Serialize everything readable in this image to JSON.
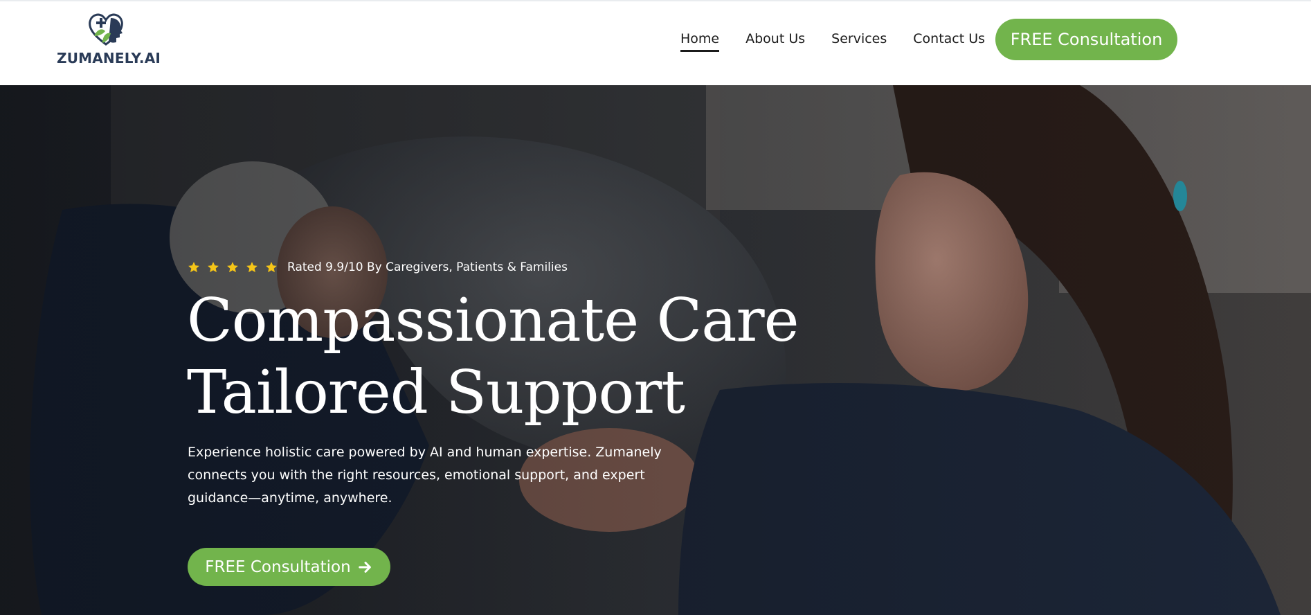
{
  "brand": {
    "name": "ZUMANELY.AI",
    "logo_icon": "heart-medical-cross-head-icon",
    "colors": {
      "green": "#72b44c",
      "navy": "#2a3b57",
      "star": "#f5c518"
    }
  },
  "nav": {
    "items": [
      {
        "label": "Home",
        "active": true
      },
      {
        "label": "About Us",
        "active": false
      },
      {
        "label": "Services",
        "active": false
      },
      {
        "label": "Contact Us",
        "active": false
      }
    ],
    "cta_label": "FREE Consultation"
  },
  "hero": {
    "rating": {
      "stars": 5,
      "text": "Rated 9.9/10 By Caregivers, Patients & Families"
    },
    "headline": [
      "Compassionate Care",
      "Tailored Support"
    ],
    "subtext_lines": [
      "Experience holistic care powered by AI and human expertise. Zumanely",
      "connects you with the right resources, emotional support, and expert",
      "guidance—anytime, anywhere."
    ],
    "cta_label": "FREE Consultation",
    "cta_icon": "arrow-right-icon"
  }
}
